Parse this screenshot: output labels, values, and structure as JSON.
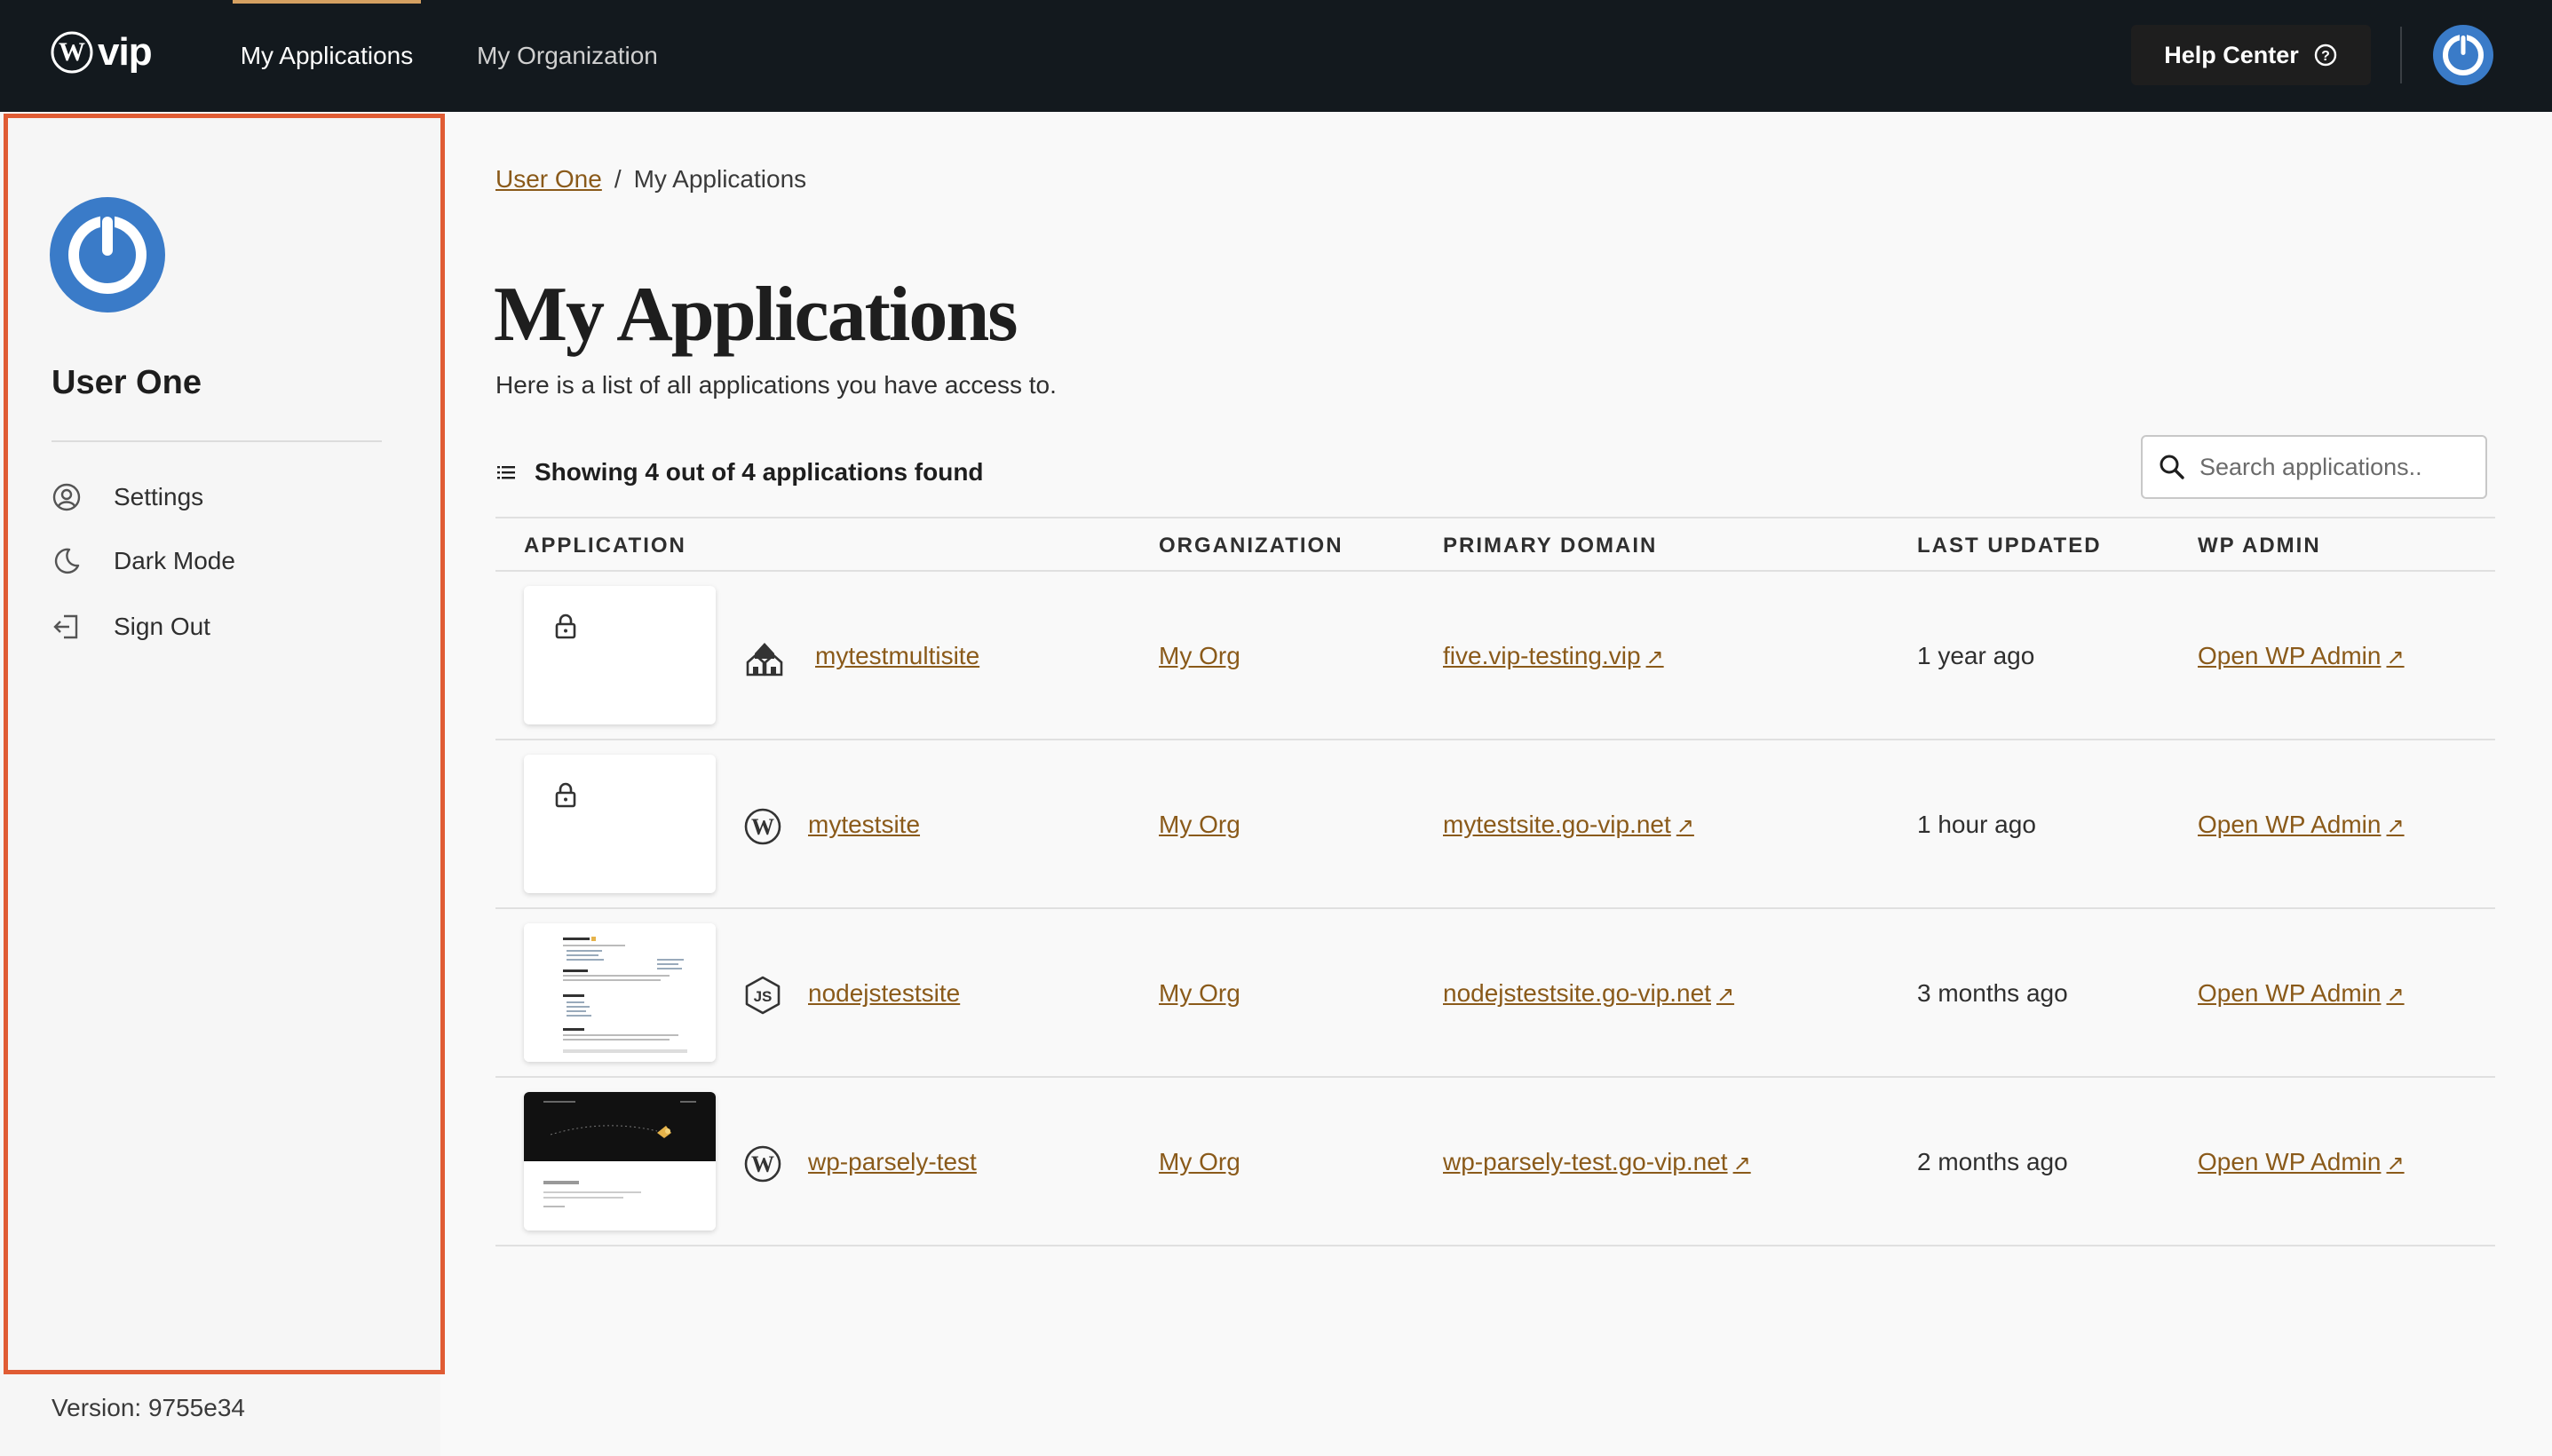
{
  "brand": {
    "logo_text": "vip"
  },
  "topnav": {
    "items": [
      {
        "label": "My Applications",
        "active": true
      },
      {
        "label": "My Organization",
        "active": false
      }
    ],
    "help_label": "Help Center"
  },
  "sidebar": {
    "user_name": "User One",
    "items": [
      {
        "label": "Settings",
        "icon": "user-circle-icon"
      },
      {
        "label": "Dark Mode",
        "icon": "moon-icon"
      },
      {
        "label": "Sign Out",
        "icon": "sign-out-icon"
      }
    ],
    "version": "Version: 9755e34"
  },
  "breadcrumb": {
    "parent": "User One",
    "separator": "/",
    "current": "My Applications"
  },
  "main": {
    "title": "My Applications",
    "subtitle": "Here is a list of all applications you have access to.",
    "showing": "Showing 4 out of 4 applications found",
    "search_placeholder": "Search applications.."
  },
  "table": {
    "headers": {
      "application": "APPLICATION",
      "organization": "ORGANIZATION",
      "domain": "PRIMARY DOMAIN",
      "updated": "LAST UPDATED",
      "admin": "WP ADMIN"
    },
    "rows": [
      {
        "name": "mytestmultisite",
        "type_icon": "multisite-icon",
        "thumb": "locked",
        "org": "My Org",
        "domain": "five.vip-testing.vip",
        "updated": "1 year ago",
        "admin": "Open WP Admin"
      },
      {
        "name": "mytestsite",
        "type_icon": "wordpress-icon",
        "thumb": "locked",
        "org": "My Org",
        "domain": "mytestsite.go-vip.net",
        "updated": "1 hour ago",
        "admin": "Open WP Admin"
      },
      {
        "name": "nodejstestsite",
        "type_icon": "nodejs-icon",
        "thumb": "docs-screenshot",
        "org": "My Org",
        "domain": "nodejstestsite.go-vip.net",
        "updated": "3 months ago",
        "admin": "Open WP Admin"
      },
      {
        "name": "wp-parsely-test",
        "type_icon": "wordpress-icon",
        "thumb": "dark-site-screenshot",
        "org": "My Org",
        "domain": "wp-parsely-test.go-vip.net",
        "updated": "2 months ago",
        "admin": "Open WP Admin"
      }
    ],
    "external_arrow": "↗"
  },
  "colors": {
    "topbar": "#13191e",
    "accent": "#d5a061",
    "link": "#8a5a1a",
    "highlight_border": "#e05c34",
    "avatar_blue": "#3a7bc8"
  }
}
